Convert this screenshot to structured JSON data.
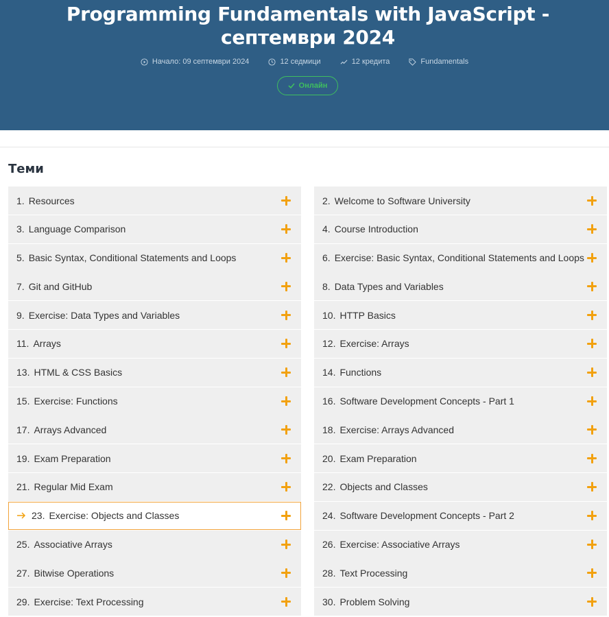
{
  "header": {
    "title": "Programming Fundamentals with JavaScript - септември 2024",
    "meta": {
      "start": "Начало: 09 септември 2024",
      "duration": "12 седмици",
      "credits": "12 кредита",
      "category": "Fundamentals"
    },
    "badge": "Онлайн"
  },
  "topics_section": {
    "title": "Теми",
    "left": [
      {
        "num": "1.",
        "label": "Resources"
      },
      {
        "num": "3.",
        "label": "Language Comparison"
      },
      {
        "num": "5.",
        "label": "Basic Syntax, Conditional Statements and Loops"
      },
      {
        "num": "7.",
        "label": "Git and GitHub"
      },
      {
        "num": "9.",
        "label": "Exercise: Data Types and Variables"
      },
      {
        "num": "11.",
        "label": "Arrays"
      },
      {
        "num": "13.",
        "label": "HTML & CSS Basics"
      },
      {
        "num": "15.",
        "label": "Exercise: Functions"
      },
      {
        "num": "17.",
        "label": "Arrays Advanced"
      },
      {
        "num": "19.",
        "label": "Exam Preparation"
      },
      {
        "num": "21.",
        "label": "Regular Mid Exam"
      },
      {
        "num": "23.",
        "label": "Exercise: Objects and Classes",
        "active": true
      },
      {
        "num": "25.",
        "label": "Associative Arrays"
      },
      {
        "num": "27.",
        "label": "Bitwise Operations"
      },
      {
        "num": "29.",
        "label": "Exercise: Text Processing"
      }
    ],
    "right": [
      {
        "num": "2.",
        "label": "Welcome to Software University"
      },
      {
        "num": "4.",
        "label": "Course Introduction"
      },
      {
        "num": "6.",
        "label": "Exercise: Basic Syntax, Conditional Statements and Loops"
      },
      {
        "num": "8.",
        "label": "Data Types and Variables"
      },
      {
        "num": "10.",
        "label": "HTTP Basics"
      },
      {
        "num": "12.",
        "label": "Exercise: Arrays"
      },
      {
        "num": "14.",
        "label": "Functions"
      },
      {
        "num": "16.",
        "label": "Software Development Concepts - Part 1"
      },
      {
        "num": "18.",
        "label": "Exercise: Arrays Advanced"
      },
      {
        "num": "20.",
        "label": "Exam Preparation"
      },
      {
        "num": "22.",
        "label": "Objects and Classes"
      },
      {
        "num": "24.",
        "label": "Software Development Concepts - Part 2"
      },
      {
        "num": "26.",
        "label": "Exercise: Associative Arrays"
      },
      {
        "num": "28.",
        "label": "Text Processing"
      },
      {
        "num": "30.",
        "label": "Problem Solving"
      }
    ]
  },
  "colors": {
    "header_bg": "#2f5e85",
    "accent_orange": "#f2a10f",
    "online_green": "#3fbf5f",
    "row_bg": "#efefef"
  }
}
